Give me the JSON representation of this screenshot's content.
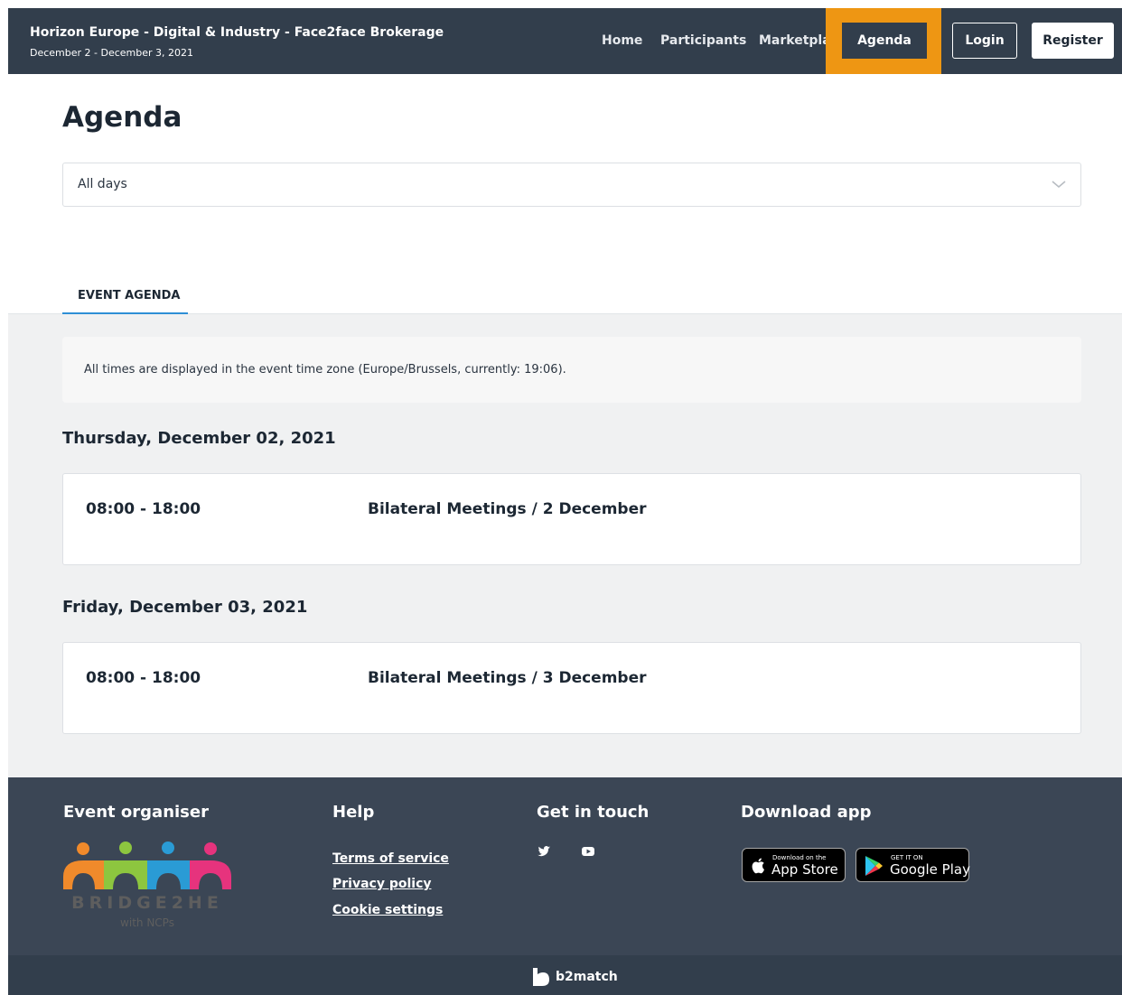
{
  "header": {
    "event_title": "Horizon Europe - Digital & Industry - Face2face Brokerage",
    "event_dates": "December 2 - December 3, 2021",
    "nav": {
      "home": "Home",
      "participants": "Participants",
      "marketplace": "Marketplace",
      "agenda": "Agenda"
    },
    "login": "Login",
    "register": "Register"
  },
  "page": {
    "title": "Agenda",
    "day_filter": {
      "selected": "All days"
    },
    "tab": "EVENT AGENDA",
    "timezone_note": "All times are displayed in the event time zone (Europe/Brussels, currently: 19:06)."
  },
  "days": [
    {
      "heading": "Thursday, December 02, 2021",
      "sessions": [
        {
          "time": "08:00 - 18:00",
          "title": "Bilateral Meetings / 2 December"
        }
      ]
    },
    {
      "heading": "Friday, December 03, 2021",
      "sessions": [
        {
          "time": "08:00 - 18:00",
          "title": "Bilateral Meetings / 3 December"
        }
      ]
    }
  ],
  "footer": {
    "organiser_heading": "Event organiser",
    "organiser_logo_text": "BRIDGE2HE",
    "organiser_logo_sub": "with NCPs",
    "help_heading": "Help",
    "help_links": [
      "Terms of service",
      "Privacy policy",
      "Cookie settings"
    ],
    "contact_heading": "Get in touch",
    "social_icons": [
      "twitter-icon",
      "youtube-icon"
    ],
    "app_heading": "Download app",
    "app_store": {
      "small": "Download on the",
      "big": "App Store"
    },
    "google_play": {
      "small": "GET IT ON",
      "big": "Google Play"
    },
    "brand": "b2match"
  },
  "colors": {
    "header_bg": "#323e4c",
    "highlight": "#ee9613",
    "tab_accent": "#2e8fd6",
    "footer_bg": "#3b4655"
  }
}
